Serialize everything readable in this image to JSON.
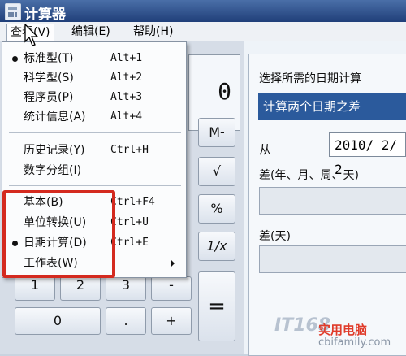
{
  "window": {
    "title": "计算器"
  },
  "menubar": {
    "items": [
      "查看(V)",
      "编辑(E)",
      "帮助(H)"
    ]
  },
  "display": {
    "value": "0"
  },
  "keys": {
    "mminus": "M-",
    "sqrt": "√",
    "percent": "%",
    "reciprocal": "1/x",
    "one": "1",
    "two": "2",
    "three": "3",
    "minus": "-",
    "zero": "0",
    "dot": ".",
    "plus": "+",
    "equals": "="
  },
  "view_menu": {
    "standard": {
      "label": "标准型(T)",
      "shortcut": "Alt+1"
    },
    "scientific": {
      "label": "科学型(S)",
      "shortcut": "Alt+2"
    },
    "programmer": {
      "label": "程序员(P)",
      "shortcut": "Alt+3"
    },
    "statistics": {
      "label": "统计信息(A)",
      "shortcut": "Alt+4"
    },
    "history": {
      "label": "历史记录(Y)",
      "shortcut": "Ctrl+H"
    },
    "grouping": {
      "label": "数字分组(I)",
      "shortcut": ""
    },
    "basic": {
      "label": "基本(B)",
      "shortcut": "Ctrl+F4"
    },
    "unit": {
      "label": "单位转换(U)",
      "shortcut": "Ctrl+U"
    },
    "date": {
      "label": "日期计算(D)",
      "shortcut": "Ctrl+E"
    },
    "worksheet": {
      "label": "工作表(W)",
      "shortcut": ""
    }
  },
  "date_panel": {
    "heading": "选择所需的日期计算",
    "mode": "计算两个日期之差",
    "from_label": "从",
    "from_value": "2010/ 2/ 2",
    "diff_label": "差(年、月、周、天)",
    "days_label": "差(天)"
  },
  "watermark": {
    "logo": "IT168",
    "text": "实用电脑",
    "url": "cbifamily.com"
  }
}
